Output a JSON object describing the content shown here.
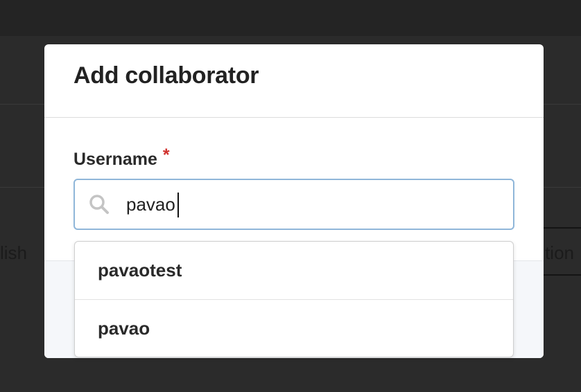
{
  "background": {
    "left_text": "lish",
    "right_text": "tion"
  },
  "modal": {
    "title": "Add collaborator",
    "field": {
      "label": "Username",
      "required_mark": "*",
      "value": "pavao",
      "icon": "search-icon"
    }
  },
  "dropdown": {
    "items": [
      {
        "label": "pavaotest"
      },
      {
        "label": "pavao"
      }
    ]
  },
  "colors": {
    "input_border": "#8fb6d9",
    "required": "#d0312d",
    "accent_button": "#3a78c2"
  }
}
